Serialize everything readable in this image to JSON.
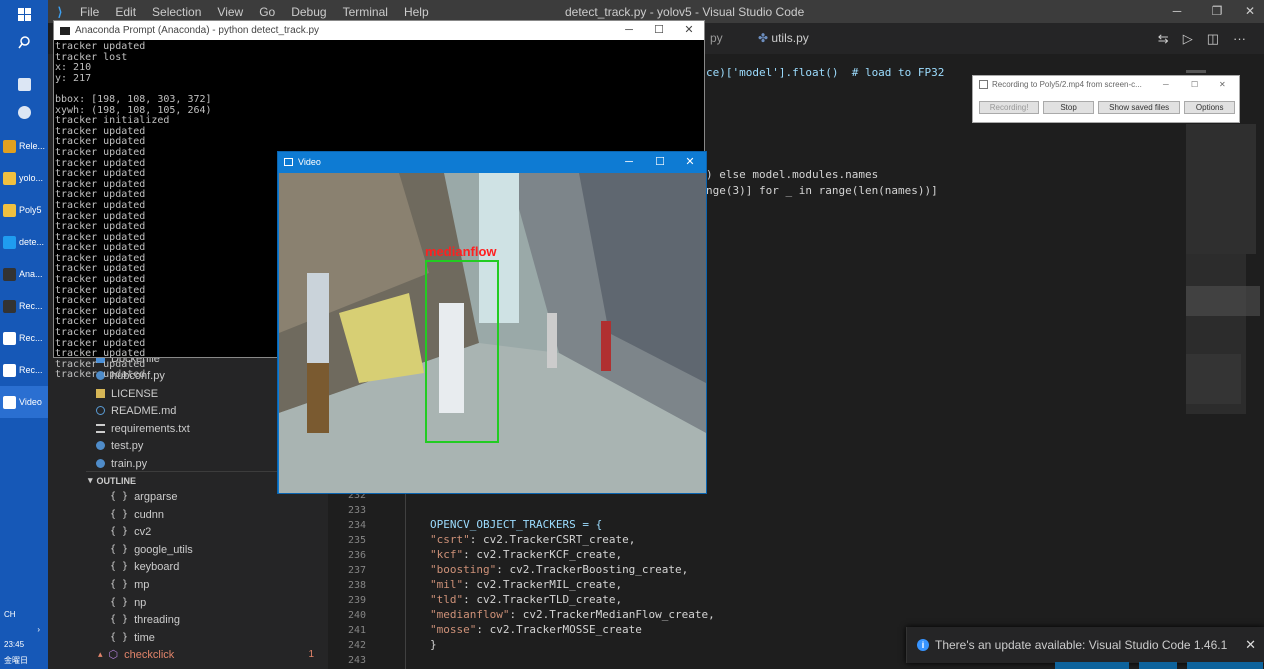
{
  "taskbar": {
    "items": [
      {
        "label": "Rele...",
        "icon": "chrome-icon",
        "color": "#e0a020"
      },
      {
        "label": "yolo...",
        "icon": "folder-icon",
        "color": "#f0c040"
      },
      {
        "label": "Poly5",
        "icon": "folder-icon",
        "color": "#f0c040"
      },
      {
        "label": "dete...",
        "icon": "vscode-icon",
        "color": "#1f9cf0"
      },
      {
        "label": "Ana...",
        "icon": "terminal-icon",
        "color": "#333333"
      },
      {
        "label": "Rec...",
        "icon": "terminal-icon",
        "color": "#333333"
      },
      {
        "label": "Rec...",
        "icon": "recorder-icon",
        "color": "#ffffff"
      },
      {
        "label": "Rec...",
        "icon": "recorder-icon",
        "color": "#ffffff"
      },
      {
        "label": "Video",
        "icon": "window-icon",
        "color": "#ffffff"
      }
    ],
    "lang": "CH",
    "time": "23:45",
    "date": "金曜日"
  },
  "vscode": {
    "menu": [
      "File",
      "Edit",
      "Selection",
      "View",
      "Go",
      "Debug",
      "Terminal",
      "Help"
    ],
    "window_title": "detect_track.py - yolov5 - Visual Studio Code",
    "tabs": [
      "py",
      "utils.py"
    ],
    "files": [
      "Dockerfile",
      "hubconf.py",
      "LICENSE",
      "README.md",
      "requirements.txt",
      "test.py",
      "train.py"
    ],
    "outline_title": "OUTLINE",
    "outline": [
      "argparse",
      "cudnn",
      "cv2",
      "google_utils",
      "keyboard",
      "mp",
      "np",
      "threading",
      "time",
      "checkclick"
    ],
    "outline_badge": "1",
    "code_top": [
      "ce)['model'].float()  # load to FP32",
      ") else model.modules.names",
      "nge(3)] for _ in range(len(names))]"
    ],
    "line_numbers": [
      "232",
      "233",
      "234",
      "235",
      "236",
      "237",
      "238",
      "239",
      "240",
      "241",
      "242",
      "243"
    ],
    "code": {
      "l234": "OPENCV_OBJECT_TRACKERS = {",
      "l235_key": "\"csrt\"",
      "l235_val": ": cv2.TrackerCSRT_create,",
      "l236_key": "\"kcf\"",
      "l236_val": ": cv2.TrackerKCF_create,",
      "l237_key": "\"boosting\"",
      "l237_val": ": cv2.TrackerBoosting_create,",
      "l238_key": "\"mil\"",
      "l238_val": ": cv2.TrackerMIL_create,",
      "l239_key": "\"tld\"",
      "l239_val": ": cv2.TrackerTLD_create,",
      "l240_key": "\"medianflow\"",
      "l240_val": ": cv2.TrackerMedianFlow_create,",
      "l241_key": "\"mosse\"",
      "l241_val": ": cv2.TrackerMOSSE_create",
      "l242": "}"
    },
    "notification": "There's an update available: Visual Studio Code 1.46.1"
  },
  "anaconda": {
    "title": "Anaconda Prompt (Anaconda) - python  detect_track.py",
    "lines": [
      "tracker updated",
      "tracker lost",
      "x: 210",
      "y: 217",
      "",
      "bbox: [198, 108, 303, 372]",
      "xywh: (198, 108, 105, 264)",
      "tracker initialized",
      "tracker updated",
      "tracker updated",
      "tracker updated",
      "tracker updated",
      "tracker updated",
      "tracker updated",
      "tracker updated",
      "tracker updated",
      "tracker updated",
      "tracker updated",
      "tracker updated",
      "tracker updated",
      "tracker updated",
      "tracker updated",
      "tracker updated",
      "tracker updated",
      "tracker updated",
      "tracker updated",
      "tracker updated",
      "tracker updated",
      "tracker updated",
      "tracker updated",
      "tracker updated",
      "tracker updated"
    ]
  },
  "video": {
    "title": "Video",
    "tracker_label": "medianflow",
    "box_color": "#22cc22",
    "label_color": "#ff2020"
  },
  "recorder": {
    "title": "Recording to Poly5/2.mp4 from screen-c...",
    "buttons": [
      "Recording!",
      "Stop",
      "Show saved files",
      "Options"
    ]
  }
}
